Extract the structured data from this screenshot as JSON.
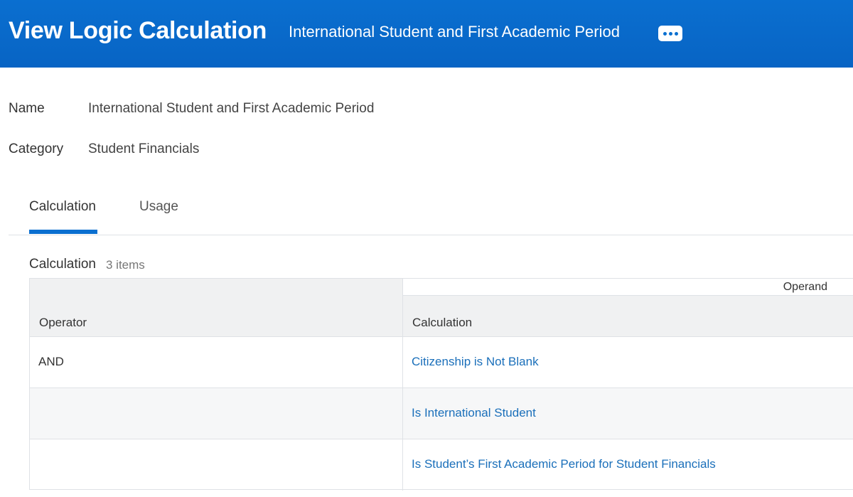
{
  "header": {
    "title": "View Logic Calculation",
    "subtitle": "International Student and First Academic Period",
    "related_actions_icon": "more-horizontal-icon",
    "background_color": "#0a6fd0"
  },
  "fields": {
    "name_label": "Name",
    "name_value": "International Student and First Academic Period",
    "category_label": "Category",
    "category_value": "Student Financials"
  },
  "tabs": [
    {
      "label": "Calculation",
      "active": true
    },
    {
      "label": "Usage",
      "active": false
    }
  ],
  "grid": {
    "title": "Calculation",
    "count": "3 items",
    "group_header": "Operand",
    "columns": {
      "operator": "Operator",
      "calculation": "Calculation"
    },
    "rows": [
      {
        "operator": "AND",
        "calculation": "Citizenship is Not Blank"
      },
      {
        "operator": "",
        "calculation": "Is International Student"
      },
      {
        "operator": "",
        "calculation": "Is Student’s First Academic Period for Student Financials"
      }
    ]
  },
  "colors": {
    "accent": "#0a6fd0",
    "link": "#1a6fba",
    "header_bg": "#f0f1f2"
  }
}
